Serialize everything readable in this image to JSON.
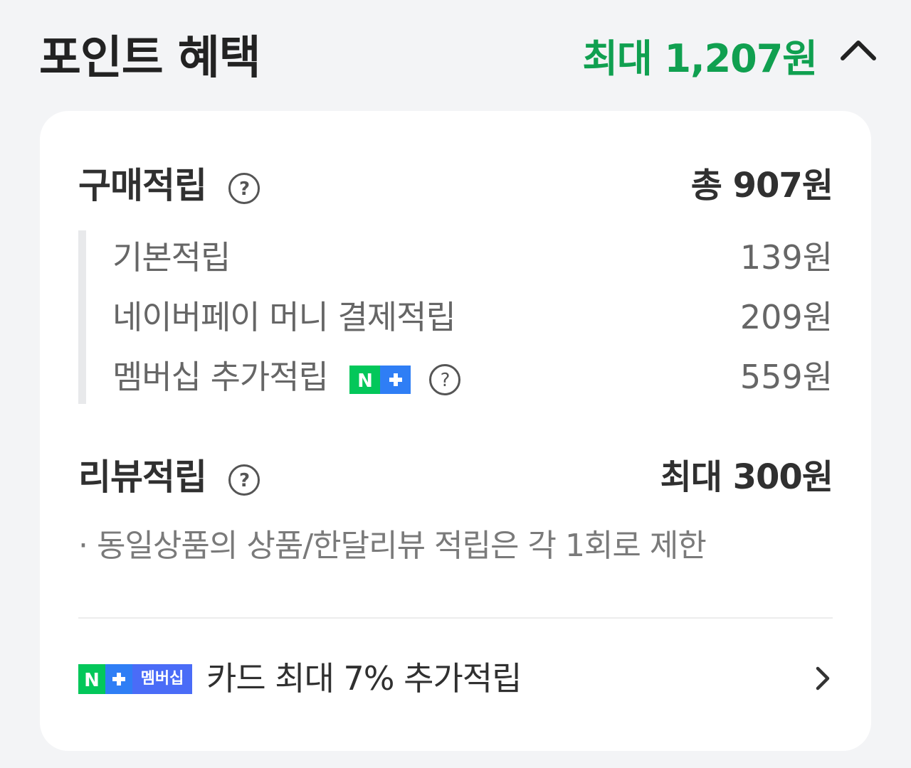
{
  "header": {
    "title": "포인트 혜택",
    "total": "최대 1,207원"
  },
  "purchase": {
    "title": "구매적립",
    "total": "총 907원",
    "items": [
      {
        "label": "기본적립",
        "value": "139원"
      },
      {
        "label": "네이버페이 머니 결제적립",
        "value": "209원"
      },
      {
        "label": "멤버십 추가적립",
        "value": "559원"
      }
    ]
  },
  "review": {
    "title": "리뷰적립",
    "total": "최대 300원",
    "note": "· 동일상품의 상품/한달리뷰 적립은 각 1회로 제한"
  },
  "card_benefit": {
    "badge_text": "멤버십",
    "label": "카드 최대 7% 추가적립"
  },
  "colors": {
    "accent_green": "#10a050",
    "badge_green": "#03c75a",
    "badge_blue": "#3b82f6"
  },
  "icons": {
    "collapse": "chevron-up-icon",
    "help": "question-circle-icon",
    "more": "chevron-right-icon"
  }
}
